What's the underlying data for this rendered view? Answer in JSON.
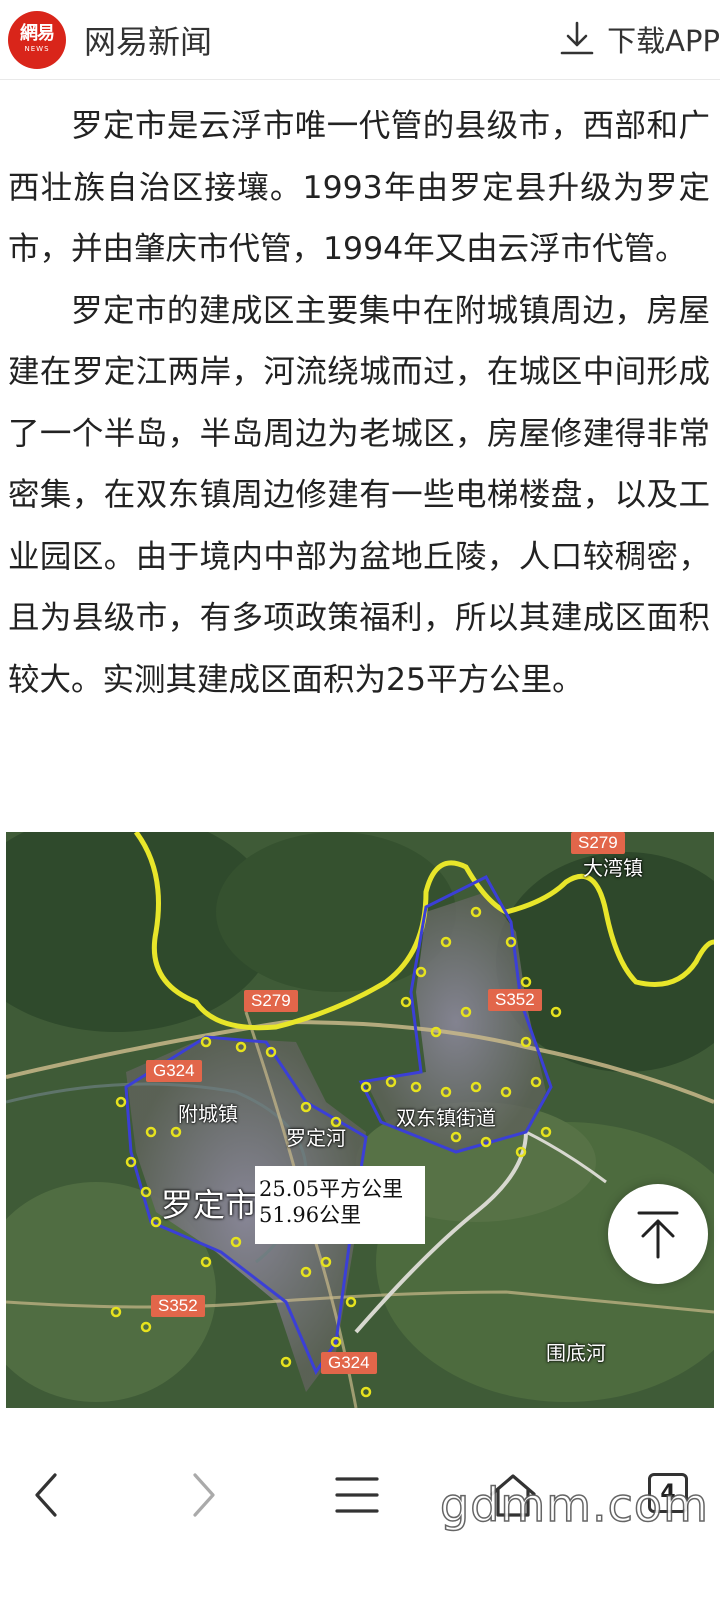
{
  "header": {
    "logo": {
      "main": "網易",
      "sub": "NEWS"
    },
    "app_name": "网易新闻",
    "download_label": "下载APP"
  },
  "article": {
    "paragraphs": [
      "罗定市是云浮市唯一代管的县级市，西部和广西壮族自治区接壤。1993年由罗定县升级为罗定市，并由肇庆市代管，1994年又由云浮市代管。",
      "罗定市的建成区主要集中在附城镇周边，房屋建在罗定江两岸，河流绕城而过，在城区中间形成了一个半岛，半岛周边为老城区，房屋修建得非常密集，在双东镇周边修建有一些电梯楼盘，以及工业园区。由于境内中部为盆地丘陵，人口较稠密，且为县级市，有多项政策福利，所以其建成区面积较大。实测其建成区面积为25平方公里。"
    ]
  },
  "map": {
    "roads": {
      "s279_top": "S279",
      "s279_mid": "S279",
      "s352_right": "S352",
      "g324_top": "G324",
      "s352_left": "S352",
      "g324_bottom": "G324"
    },
    "places": {
      "dawan": "大湾镇",
      "fucheng": "附城镇",
      "river": "罗定河",
      "shuangdong": "双东镇街道",
      "luoding": "罗定市",
      "weidihe": "围底河"
    },
    "measure": {
      "area": "25.05平方公里",
      "perimeter": "51.96公里"
    },
    "colors": {
      "boundary": "#e8e62a",
      "builtup": "#3b3fd6",
      "marker": "#e6e21e",
      "road_badge": "#e2664a"
    }
  },
  "back_to_top": {
    "icon": "arrow-up-icon"
  },
  "bottom_bar": {
    "tab_count": "4",
    "watermark": "gdmm.com",
    "icons": [
      "back-icon",
      "forward-icon",
      "menu-icon",
      "home-icon",
      "tabs-icon"
    ]
  }
}
